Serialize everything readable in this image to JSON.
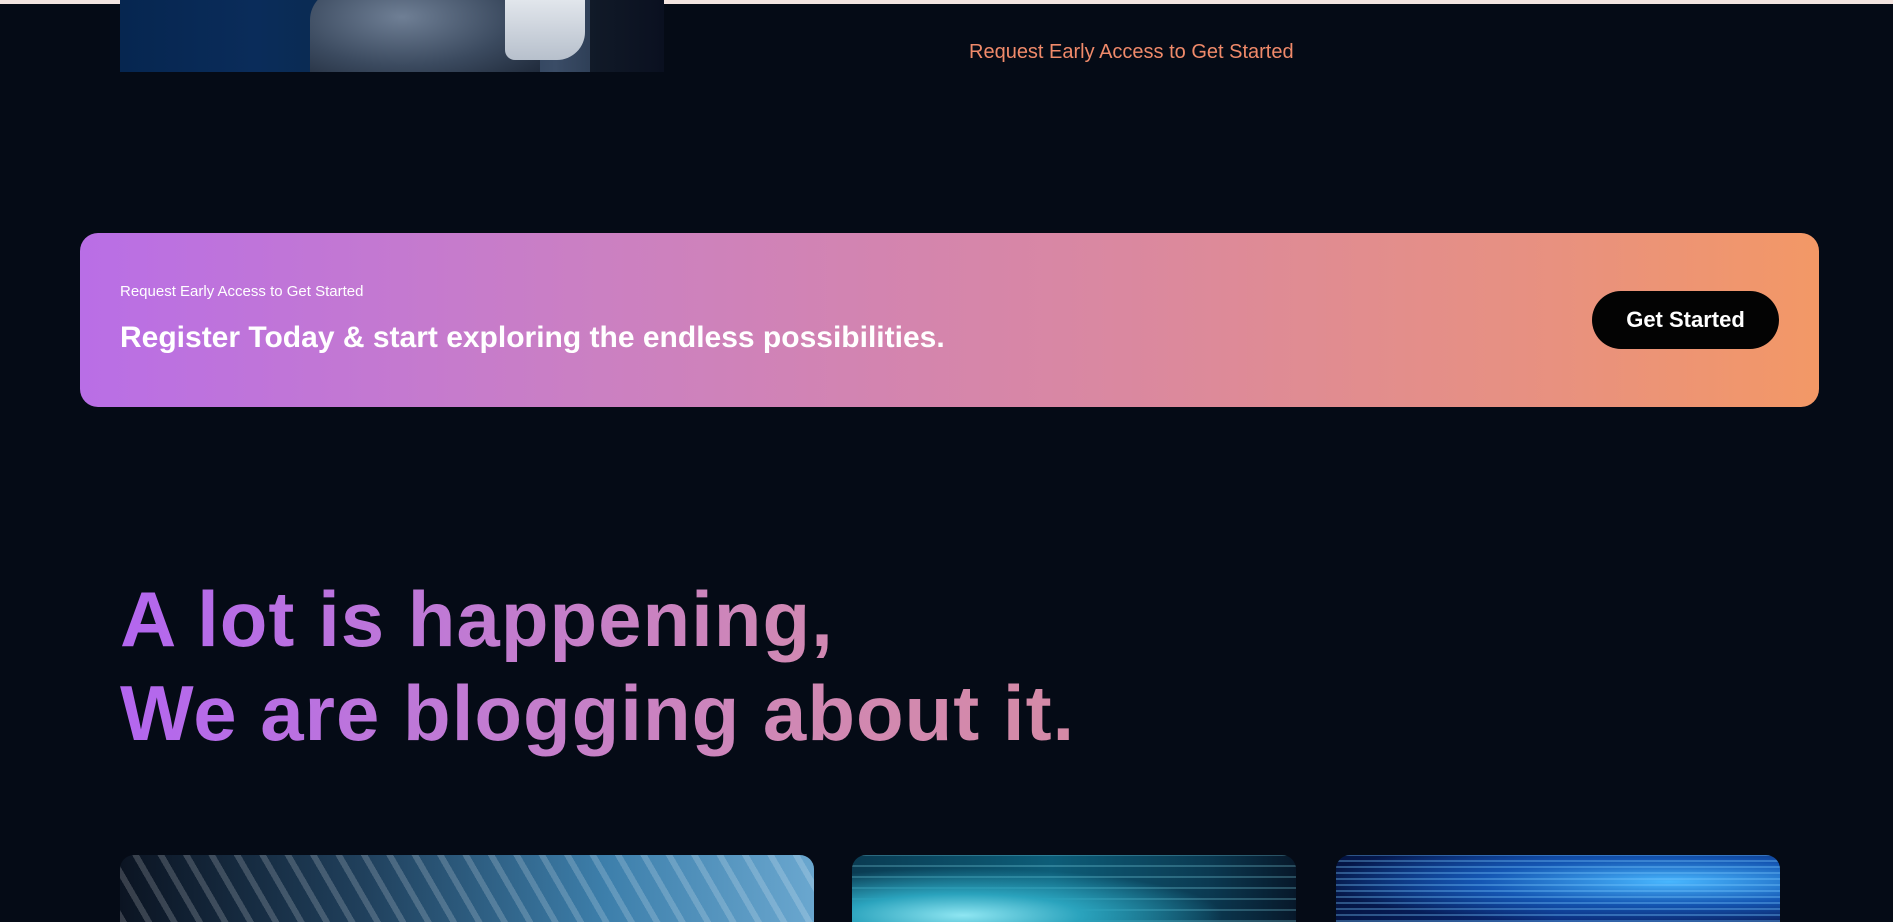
{
  "top_section": {
    "early_access_link": "Request Early Access to Get Started"
  },
  "cta_banner": {
    "eyebrow": "Request Early Access to Get Started",
    "title": "Register Today & start exploring the endless possibilities.",
    "button_label": "Get Started"
  },
  "blog": {
    "heading_line_1": "A lot is happening,",
    "heading_line_2": "We are blogging about it."
  },
  "colors": {
    "page_background": "#050b16",
    "link_accent": "#f08a6a",
    "gradient_start": "#b96ee6",
    "gradient_end": "#f39866",
    "button_background": "#030303"
  }
}
